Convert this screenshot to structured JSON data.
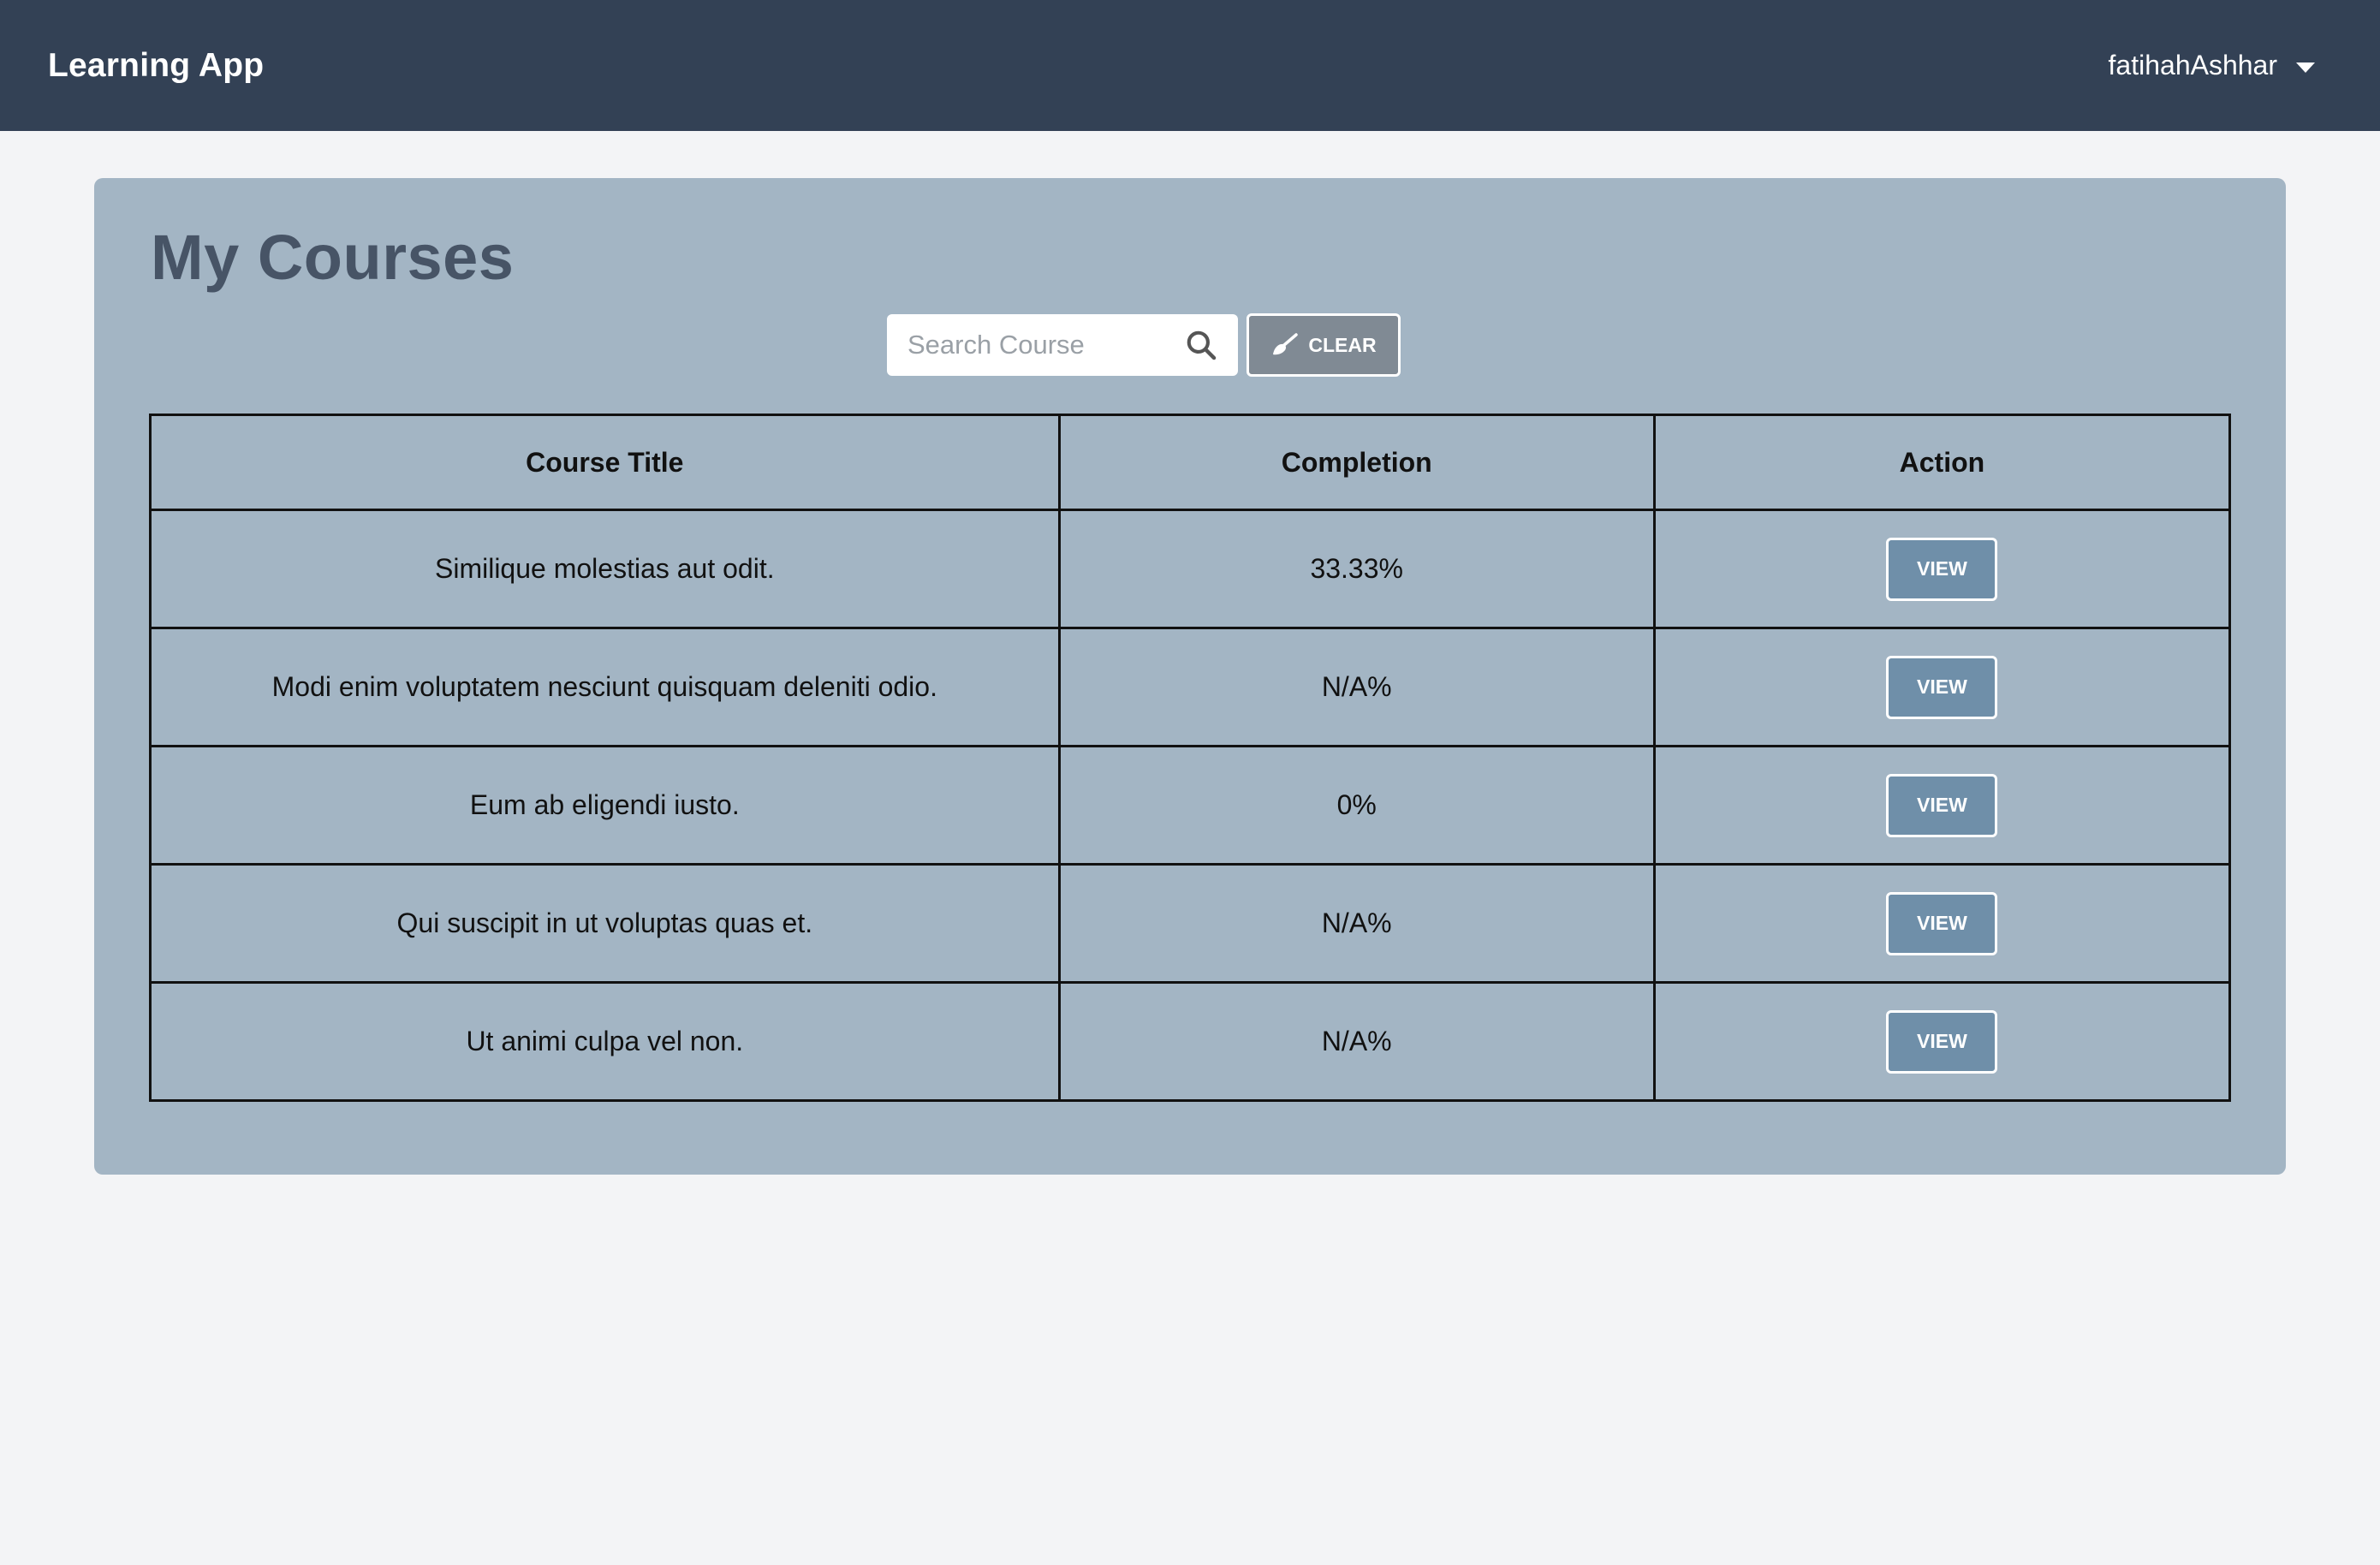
{
  "app": {
    "title": "Learning App"
  },
  "user": {
    "name": "fatihahAshhar",
    "menu_icon": "caret-down-icon"
  },
  "page": {
    "title": "My Courses"
  },
  "search": {
    "placeholder": "Search Course",
    "value": "",
    "icon": "search-icon"
  },
  "clear_button": {
    "label": "CLEAR",
    "icon": "brush-icon"
  },
  "table": {
    "headers": [
      "Course Title",
      "Completion",
      "Action"
    ],
    "rows": [
      {
        "title": "Similique molestias aut odit.",
        "completion": "33.33%",
        "action": "VIEW"
      },
      {
        "title": "Modi enim voluptatem nesciunt quisquam deleniti odio.",
        "completion": "N/A%",
        "action": "VIEW"
      },
      {
        "title": "Eum ab eligendi iusto.",
        "completion": "0%",
        "action": "VIEW"
      },
      {
        "title": "Qui suscipit in ut voluptas quas et.",
        "completion": "N/A%",
        "action": "VIEW"
      },
      {
        "title": "Ut animi culpa vel non.",
        "completion": "N/A%",
        "action": "VIEW"
      }
    ]
  },
  "colors": {
    "navbar": "#334155",
    "background": "#f3f4f6",
    "card": "#a3b5c4",
    "title": "#475466",
    "clear_button": "#808a94",
    "view_button": "#6f8fa9"
  }
}
